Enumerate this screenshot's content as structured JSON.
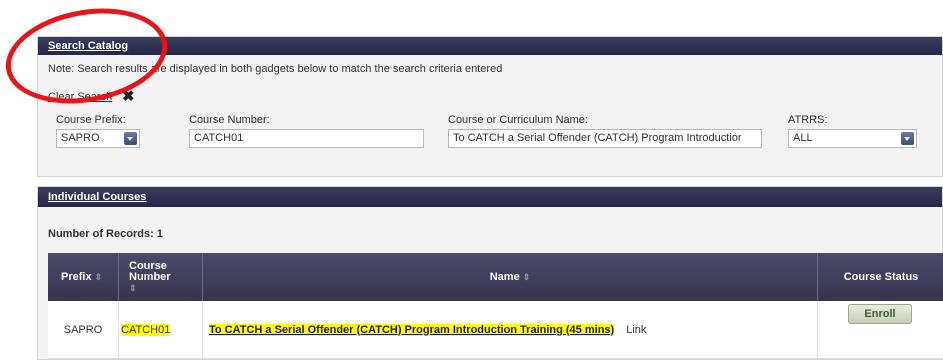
{
  "search": {
    "title": "Search Catalog",
    "note": "Note: Search results are displayed in both gadgets below to match the search criteria entered",
    "clear_label": "Clear Search",
    "clear_icon": "✖",
    "prefix_label": "Course Prefix:",
    "prefix_value": "SAPRO",
    "number_label": "Course Number:",
    "number_value": "CATCH01",
    "name_label": "Course or Curriculum Name:",
    "name_value": "To CATCH a Serial Offender (CATCH) Program Introductior",
    "atrrs_label": "ATRRS:",
    "atrrs_value": "ALL"
  },
  "courses": {
    "title": "Individual Courses",
    "records": "Number of Records: 1",
    "columns": {
      "prefix": "Prefix",
      "number_line1": "Course",
      "number_line2": "Number",
      "name": "Name",
      "status": "Course Status"
    },
    "sort_icon": "⇕",
    "rows": [
      {
        "prefix": "SAPRO",
        "number": "CATCH01",
        "name": "To CATCH a Serial Offender (CATCH) Program Introduction Training (45 mins)",
        "link": "Link",
        "enroll": "Enroll"
      }
    ]
  },
  "colors": {
    "header": "#26264a",
    "highlight": "#ffff00",
    "annotation": "#e8141c"
  }
}
